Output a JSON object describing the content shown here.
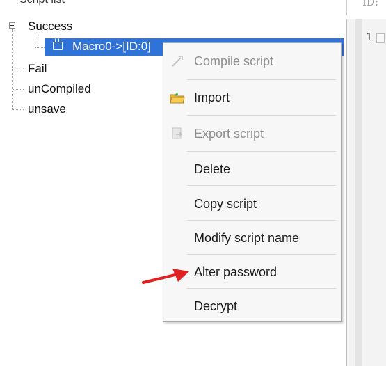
{
  "panel": {
    "title": "Script list"
  },
  "tree": {
    "root": {
      "label": "Success",
      "expanded": true
    },
    "selected_item": {
      "label": "Macro0->[ID:0]"
    },
    "siblings": [
      {
        "label": "Fail"
      },
      {
        "label": "unCompiled"
      },
      {
        "label": "unsave"
      }
    ]
  },
  "editor": {
    "header_text": "ID:",
    "line_number": "1"
  },
  "context_menu": {
    "items": [
      {
        "label": "Compile script",
        "enabled": false,
        "icon": "compile-icon"
      },
      {
        "label": "Import",
        "enabled": true,
        "icon": "folder-import-icon"
      },
      {
        "label": "Export script",
        "enabled": false,
        "icon": "export-icon"
      },
      {
        "label": "Delete",
        "enabled": true
      },
      {
        "label": "Copy script",
        "enabled": true
      },
      {
        "label": "Modify script name",
        "enabled": true
      },
      {
        "label": "Alter password",
        "enabled": true,
        "highlighted_by_arrow": true
      },
      {
        "label": "Decrypt",
        "enabled": true
      }
    ]
  },
  "colors": {
    "selection": "#2f73d8",
    "annotation_arrow": "#e02020",
    "disabled_text": "#8f8f8f"
  }
}
